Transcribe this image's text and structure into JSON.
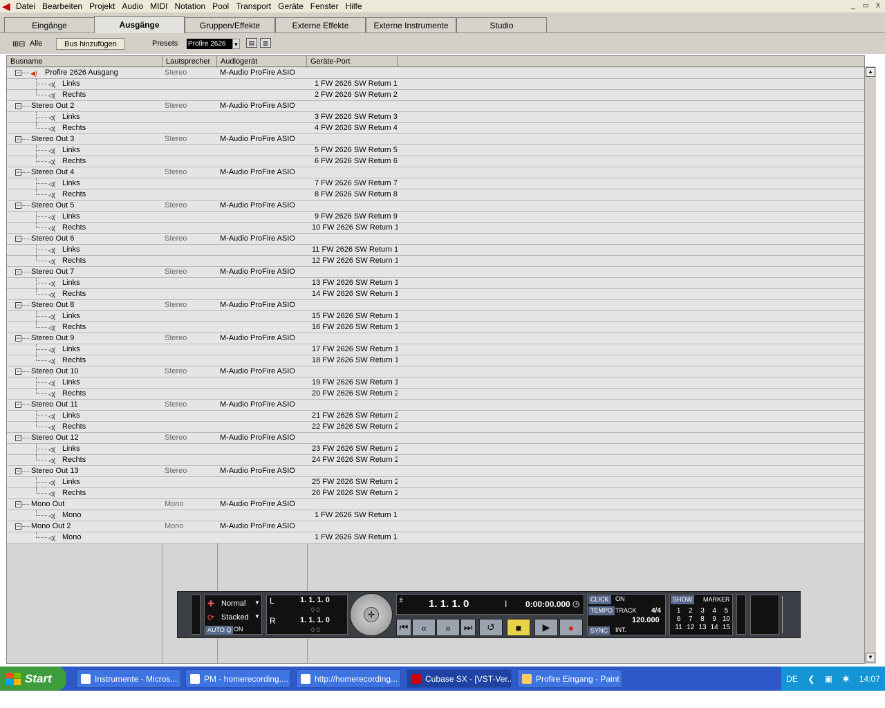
{
  "menu": {
    "items": [
      "Datei",
      "Bearbeiten",
      "Projekt",
      "Audio",
      "MIDI",
      "Notation",
      "Pool",
      "Transport",
      "Geräte",
      "Fenster",
      "Hilfe"
    ],
    "window_buttons": [
      "_",
      "▭",
      "X"
    ]
  },
  "tabs": [
    {
      "label": "Eingänge",
      "active": false
    },
    {
      "label": "Ausgänge",
      "active": true
    },
    {
      "label": "Gruppen/Effekte",
      "active": false
    },
    {
      "label": "Externe Effekte",
      "active": false
    },
    {
      "label": "Externe Instrumente",
      "active": false
    },
    {
      "label": "Studio",
      "active": false
    }
  ],
  "toolbar": {
    "expand_icons": "⊞⊟",
    "all_label": "Alle",
    "add_bus_label": "Bus hinzufügen",
    "presets_label": "Presets",
    "preset_value": "Profire 2626"
  },
  "columns": [
    "Busname",
    "Lautsprecher",
    "Audiogerät",
    "Geräte-Port"
  ],
  "buses": [
    {
      "name": "Profire 2626 Ausgang",
      "speaker": "Stereo",
      "device": "M-Audio ProFire ASIO",
      "main": true,
      "channels": [
        {
          "name": "Links",
          "port": "1 FW 2626 SW Return 1"
        },
        {
          "name": "Rechts",
          "port": "2 FW 2626 SW Return 2"
        }
      ]
    },
    {
      "name": "Stereo Out 2",
      "speaker": "Stereo",
      "device": "M-Audio ProFire ASIO",
      "channels": [
        {
          "name": "Links",
          "port": "3 FW 2626 SW Return 3"
        },
        {
          "name": "Rechts",
          "port": "4 FW 2626 SW Return 4"
        }
      ]
    },
    {
      "name": "Stereo Out 3",
      "speaker": "Stereo",
      "device": "M-Audio ProFire ASIO",
      "channels": [
        {
          "name": "Links",
          "port": "5 FW 2626 SW Return 5"
        },
        {
          "name": "Rechts",
          "port": "6 FW 2626 SW Return 6"
        }
      ]
    },
    {
      "name": "Stereo Out 4",
      "speaker": "Stereo",
      "device": "M-Audio ProFire ASIO",
      "channels": [
        {
          "name": "Links",
          "port": "7 FW 2626 SW Return 7"
        },
        {
          "name": "Rechts",
          "port": "8 FW 2626 SW Return 8"
        }
      ]
    },
    {
      "name": "Stereo Out 5",
      "speaker": "Stereo",
      "device": "M-Audio ProFire ASIO",
      "channels": [
        {
          "name": "Links",
          "port": "9 FW 2626 SW Return 9"
        },
        {
          "name": "Rechts",
          "port": "10 FW 2626 SW Return 1"
        }
      ]
    },
    {
      "name": "Stereo Out 6",
      "speaker": "Stereo",
      "device": "M-Audio ProFire ASIO",
      "channels": [
        {
          "name": "Links",
          "port": "11 FW 2626 SW Return 1"
        },
        {
          "name": "Rechts",
          "port": "12 FW 2626 SW Return 1"
        }
      ]
    },
    {
      "name": "Stereo Out 7",
      "speaker": "Stereo",
      "device": "M-Audio ProFire ASIO",
      "channels": [
        {
          "name": "Links",
          "port": "13 FW 2626 SW Return 1"
        },
        {
          "name": "Rechts",
          "port": "14 FW 2626 SW Return 1"
        }
      ]
    },
    {
      "name": "Stereo Out 8",
      "speaker": "Stereo",
      "device": "M-Audio ProFire ASIO",
      "channels": [
        {
          "name": "Links",
          "port": "15 FW 2626 SW Return 1"
        },
        {
          "name": "Rechts",
          "port": "16 FW 2626 SW Return 1"
        }
      ]
    },
    {
      "name": "Stereo Out 9",
      "speaker": "Stereo",
      "device": "M-Audio ProFire ASIO",
      "channels": [
        {
          "name": "Links",
          "port": "17 FW 2626 SW Return 1"
        },
        {
          "name": "Rechts",
          "port": "18 FW 2626 SW Return 1"
        }
      ]
    },
    {
      "name": "Stereo Out 10",
      "speaker": "Stereo",
      "device": "M-Audio ProFire ASIO",
      "channels": [
        {
          "name": "Links",
          "port": "19 FW 2626 SW Return 1"
        },
        {
          "name": "Rechts",
          "port": "20 FW 2626 SW Return 2"
        }
      ]
    },
    {
      "name": "Stereo Out 11",
      "speaker": "Stereo",
      "device": "M-Audio ProFire ASIO",
      "channels": [
        {
          "name": "Links",
          "port": "21 FW 2626 SW Return 2"
        },
        {
          "name": "Rechts",
          "port": "22 FW 2626 SW Return 2"
        }
      ]
    },
    {
      "name": "Stereo Out 12",
      "speaker": "Stereo",
      "device": "M-Audio ProFire ASIO",
      "channels": [
        {
          "name": "Links",
          "port": "23 FW 2626 SW Return 2"
        },
        {
          "name": "Rechts",
          "port": "24 FW 2626 SW Return 2"
        }
      ]
    },
    {
      "name": "Stereo Out 13",
      "speaker": "Stereo",
      "device": "M-Audio ProFire ASIO",
      "channels": [
        {
          "name": "Links",
          "port": "25 FW 2626 SW Return 2"
        },
        {
          "name": "Rechts",
          "port": "26 FW 2626 SW Return 2"
        }
      ]
    },
    {
      "name": "Mono Out",
      "speaker": "Mono",
      "device": "M-Audio ProFire ASIO",
      "channels": [
        {
          "name": "Mono",
          "port": "1 FW 2626 SW Return 1"
        }
      ]
    },
    {
      "name": "Mono Out 2",
      "speaker": "Mono",
      "device": "M-Audio ProFire ASIO",
      "channels": [
        {
          "name": "Mono",
          "port": "1 FW 2626 SW Return 1"
        }
      ]
    }
  ],
  "transport": {
    "mode_normal": "Normal",
    "mode_stacked": "Stacked",
    "auto_q": "AUTO Q",
    "auto_q_state": "ON",
    "left_locator": "1. 1. 1.    0",
    "right_locator": "1. 1. 1.    0",
    "left_sub": "0    0",
    "right_sub": "0    0",
    "position_bars": "1. 1. 1.    0",
    "position_time": "0:00:00.000",
    "click_label": "CLICK",
    "click_state": "ON",
    "tempo_label": "TEMPO",
    "tempo_mode": "TRACK",
    "signature": "4/4",
    "tempo": "120.000",
    "sync_label": "SYNC",
    "sync_state": "INT.",
    "show_label": "SHOW",
    "marker_label": "MARKER",
    "markers": [
      "1",
      "2",
      "3",
      "4",
      "5",
      "6",
      "7",
      "8",
      "9",
      "10",
      "11",
      "12",
      "13",
      "14",
      "15"
    ],
    "L": "L",
    "R": "R"
  },
  "taskbar": {
    "start_label": "Start",
    "tasks": [
      {
        "label": "Instrumente - Micros...",
        "active": false
      },
      {
        "label": "PM - homerecording....",
        "active": false
      },
      {
        "label": "http://homerecording...",
        "active": false
      },
      {
        "label": "Cubase SX - [VST-Ver...",
        "active": true
      },
      {
        "label": "Profire Eingang - Paint",
        "active": false
      }
    ],
    "language": "DE",
    "clock": "14:07"
  }
}
